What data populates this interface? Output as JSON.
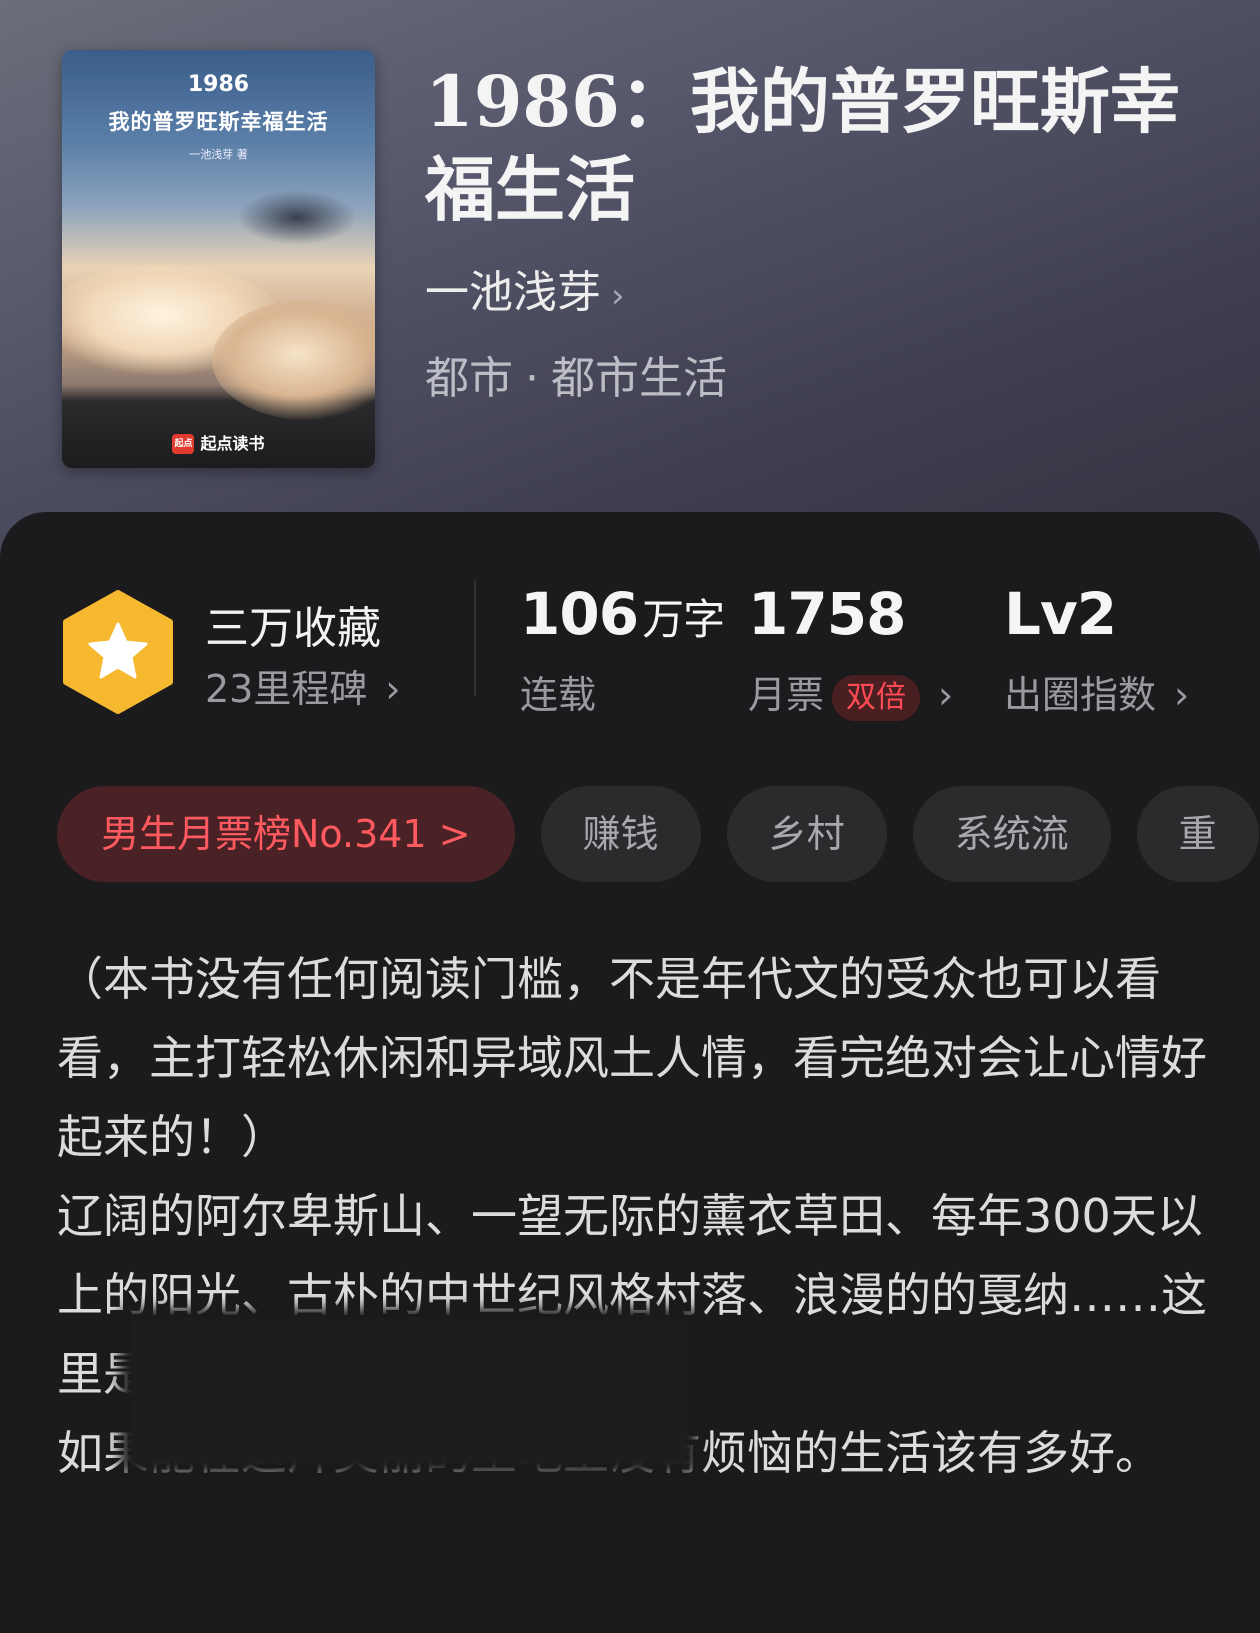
{
  "cover": {
    "year": "1986",
    "title": "我的普罗旺斯幸福生活",
    "author": "一池浅芽 著",
    "publisher": "起点读书",
    "logo_text": "起点"
  },
  "book": {
    "title": "1986：我的普罗旺斯幸福生活",
    "author": "一池浅芽",
    "author_chevron": "›",
    "genre_main": "都市",
    "genre_sep": "·",
    "genre_sub": "都市生活"
  },
  "stats": {
    "collect_title": "三万收藏",
    "milestone": "23里程碑",
    "words_num": "106",
    "words_unit": "万字",
    "words_label": "连载",
    "tickets_num": "1758",
    "tickets_label": "月票",
    "tickets_badge": "双倍",
    "level_num": "Lv2",
    "level_label": "出圈指数",
    "chevron": "›"
  },
  "tags": [
    "男生月票榜No.341 >",
    "赚钱",
    "乡村",
    "系统流",
    "重"
  ],
  "description": {
    "p1": "（本书没有任何阅读门槛，不是年代文的受众也可以看看，主打轻松休闲和异域风土人情，看完绝对会让心情好起来的！）",
    "p2": "辽阔的阿尔卑斯山、一望无际的薰衣草田、每年300天以上的阳光、古朴的中世纪风格村落、浪漫的的戛纳……这里是普罗旺中的家园。",
    "p3": "如果能在这片美丽的土地上没有烦恼的生活该有多好。"
  },
  "colors": {
    "panel_bg": "#1b1b1d",
    "accent_red": "#ff4b53",
    "badge_yellow": "#f5b82e"
  }
}
